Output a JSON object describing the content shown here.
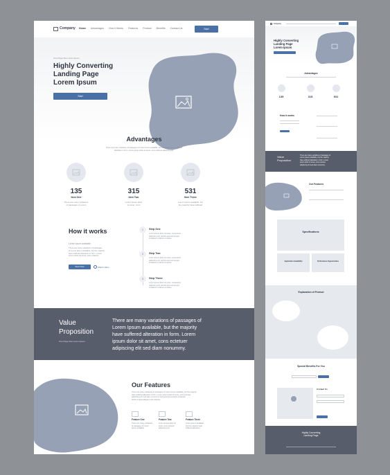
{
  "nav": {
    "brand": "Company",
    "links": [
      "Home",
      "Advantages",
      "How it Works",
      "Features",
      "Product",
      "Benefits",
      "Contact Us"
    ],
    "start_label": "Start"
  },
  "hero": {
    "kicker": "One Page Site Lorem Ipsum",
    "title_line1": "Highly Converting",
    "title_line2": "Landing Page",
    "title_line3": "Lorem Ipsum",
    "button_label": "Start"
  },
  "advantages": {
    "title": "Advantages",
    "desc_line1": "There are many variations of passages of Lorem Ipsum available, but the majority have suffered",
    "desc_line2": "alteration in form. Lorem ipsum dolor sit amet, cons ectetuer adipiscing elit.",
    "items": [
      {
        "value": "135",
        "name": "Item One",
        "text_line1": "There are many variations",
        "text_line2": "of passages of Lorem"
      },
      {
        "value": "315",
        "name": "Item Two",
        "text_line1": "Lorem ipsum dolor",
        "text_line2": "sit amet, cons"
      },
      {
        "value": "531",
        "name": "Item Three",
        "text_line1": "Lorem ipsum available, but",
        "text_line2": "the majority have suffered"
      }
    ]
  },
  "how": {
    "title": "How it works",
    "subtitle": "Lorem ipsum available",
    "body_line1": "There are many variations of passages",
    "body_line2": "of Lorem Ipsum available, but the majority",
    "body_line3": "have suffered alteration in form. Lorem",
    "body_line4": "ipsum dolor sit amet, cons ectetuer.",
    "button_label": "Start Now",
    "link_label": "Watch video",
    "steps": [
      {
        "num": "1",
        "title": "Step One",
        "line1": "Lorem ipsum dolor sit amet, consectetur",
        "line2": "adipiscing elit, sed do eiusmod tempor",
        "line3": "incididunt ut labore et dolore"
      },
      {
        "num": "2",
        "title": "Step Two",
        "line1": "Lorem ipsum dolor sit amet, consectetur",
        "line2": "adipiscing elit, sed do eiusmod tempor",
        "line3": "incididunt ut labore et dolore"
      },
      {
        "num": "3",
        "title": "Step Three",
        "line1": "Lorem ipsum dolor sit amet, consectetur",
        "line2": "adipiscing elit, sed do eiusmod tempor",
        "line3": "incididunt ut labore et dolore"
      }
    ]
  },
  "value": {
    "title_line1": "Value",
    "title_line2": "Proposition",
    "sub": "One Page Site Lorem Ipsum",
    "text_line1": "There are many variations of passages of",
    "text_line2": "Lorem Ipsum available, but the majority",
    "text_line3": "have suffered alteration in form. Lorem",
    "text_line4": "ipsum dolor sit amet, cons ectetuer",
    "text_line5": "adipiscing elit sed diam nonummy."
  },
  "features": {
    "title": "Our Features",
    "desc_line1": "There are many variations of passages of Lorem Ipsum available, but the majority",
    "desc_line2": "have suffered alteration in form. Lorem ipsum dolor sit amet, cons ectetuer",
    "desc_line3": "adipiscing elit, sed diam nonummy nibh euismod tincidunt ut laoreet",
    "desc_line4": "dolore magna aliquam erat volutpat.",
    "items": [
      {
        "name": "Feature One",
        "line1": "There are many variations",
        "line2": "of passages of Lorem",
        "line3": "Ipsum available"
      },
      {
        "name": "Feature Two",
        "line1": "Lorem ipsum dolor sit",
        "line2": "amet, cons ectetuer",
        "line3": "adipiscing elit"
      },
      {
        "name": "Feature Three",
        "line1": "Lorem ipsum available,",
        "line2": "but the majority have",
        "line3": "suffered alteration"
      }
    ]
  },
  "mini": {
    "brand": "Company",
    "hero_line1": "Highly Converting",
    "hero_line2": "Landing Page",
    "hero_line3": "Lorem Ipsum",
    "advantages": "Advantages",
    "stats": [
      "135",
      "315",
      "531"
    ],
    "how": "How it works",
    "value_line1": "Value",
    "value_line2": "Proposition",
    "value_text_line1": "There are many variations of passages of",
    "value_text_line2": "Lorem Ipsum available, but the majority",
    "value_text_line3": "have suffered alteration in form. Lorem",
    "value_text_line4": "ipsum dolor sit amet, cons ectetuer",
    "value_text_line5": "adipiscing elit sed diam nonummy.",
    "features": "Our Features",
    "specifications": "Specifications",
    "app_availability": "Application Availability",
    "perf_opportunities": "Performance Opportunities",
    "explanation": "Explanation of Product",
    "benefits": "Special Benefits For You",
    "contact": "Contact Us",
    "footer_line1": "Highly Converting",
    "footer_line2": "Landing Page"
  },
  "colors": {
    "accent": "#4a71a6",
    "blob": "#96a1b6",
    "dark": "#575d6b",
    "bg": "#8e9297"
  }
}
